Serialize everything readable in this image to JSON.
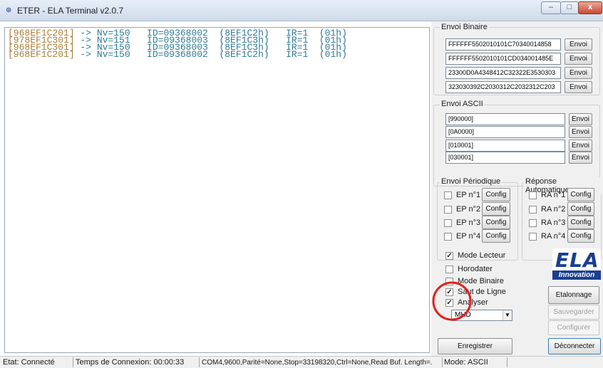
{
  "window": {
    "title": "ETER - ELA Terminal v2.0.7",
    "app_icon": "ETER-app-icon",
    "min_label": "–",
    "max_label": "□",
    "close_label": "x"
  },
  "terminal": {
    "lines": [
      {
        "addr": "[968EF1C201]",
        "rest": " -> Nv=150   ID=09368002  (8EF1C2h)   IR=1  (01h)"
      },
      {
        "addr": "[978EF1C301]",
        "rest": " -> Nv=151   ID=09368003  (8EF1C3h)   IR=1  (01h)"
      },
      {
        "addr": "[968EF1C301]",
        "rest": " -> Nv=150   ID=09368003  (8EF1C3h)   IR=1  (01h)"
      },
      {
        "addr": "[968EF1C201]",
        "rest": " -> Nv=150   ID=09368002  (8EF1C2h)   IR=1  (01h)"
      }
    ]
  },
  "envoi_binaire": {
    "title": "Envoi Binaire",
    "rows": [
      {
        "value": "FFFFFF5502010101C70340014858",
        "button": "Envoi"
      },
      {
        "value": "FFFFFF5502010101CD034001485E",
        "button": "Envoi"
      },
      {
        "value": "23300D0A4348412C32322E3530303",
        "button": "Envoi"
      },
      {
        "value": "323030392C2030312C2032312C203",
        "button": "Envoi"
      }
    ]
  },
  "envoi_ascii": {
    "title": "Envoi ASCII",
    "rows": [
      {
        "value": "[990000]",
        "button": "Envoi"
      },
      {
        "value": "[0A0000]",
        "button": "Envoi"
      },
      {
        "value": "[010001]",
        "button": "Envoi"
      },
      {
        "value": "[030001]",
        "button": "Envoi"
      }
    ]
  },
  "envoi_periodique": {
    "title": "Envoi Périodique",
    "items": [
      {
        "label": "EP n°1",
        "button": "Config"
      },
      {
        "label": "EP n°2",
        "button": "Config"
      },
      {
        "label": "EP n°3",
        "button": "Config"
      },
      {
        "label": "EP n°4",
        "button": "Config"
      }
    ]
  },
  "reponse_automatique": {
    "title": "Réponse Automatique",
    "items": [
      {
        "label": "RA n°1",
        "button": "Config"
      },
      {
        "label": "RA n°2",
        "button": "Config"
      },
      {
        "label": "RA n°3",
        "button": "Config"
      },
      {
        "label": "RA n°4",
        "button": "Config"
      }
    ]
  },
  "options": {
    "mode_lecteur": {
      "label": "Mode Lecteur",
      "checked": true
    },
    "horodater": {
      "label": "Horodater",
      "checked": false
    },
    "mode_binaire": {
      "label": "Mode Binaire",
      "checked": false
    },
    "saut_de_ligne": {
      "label": "Saut de Ligne",
      "checked": true
    },
    "analyser": {
      "label": "Analyser",
      "checked": true
    },
    "analyser_select": "MHD",
    "check_mark": "✓"
  },
  "logo": {
    "line1": "ELA",
    "line2": "Innovation"
  },
  "buttons": {
    "etalonnage": "Etalonnage",
    "sauvegarder": "Sauvegarder",
    "configurer": "Configurer",
    "enregistrer": "Enregistrer",
    "deconnecter": "Déconnecter"
  },
  "status": {
    "etat": "Etat: Connecté",
    "temps": "Temps de Connexion: 00:00:33",
    "port": "COM4,9600,Parité=None,Stop=33198320,Ctrl=None,Read Buf. Length=.",
    "mode": "Mode: ASCII"
  },
  "colors": {
    "addr": "#a7803a",
    "value": "#2f7a94",
    "highlight_circle": "#e0201a"
  }
}
